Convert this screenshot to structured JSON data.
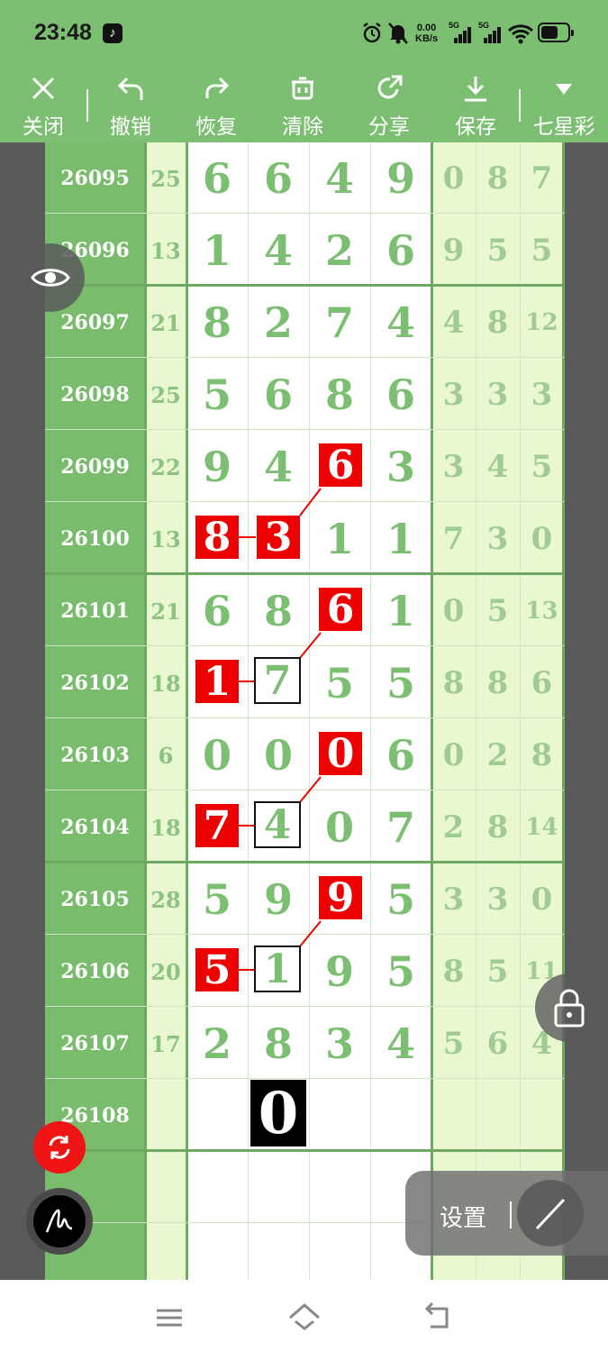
{
  "status": {
    "time": "23:48",
    "net_speed_value": "0.00",
    "net_speed_unit": "KB/s",
    "sim1": "5G",
    "sim2": "5G"
  },
  "toolbar": {
    "close": "关闭",
    "undo": "撤销",
    "redo": "恢复",
    "clear": "清除",
    "share": "分享",
    "save": "保存",
    "lottery": "七星彩"
  },
  "rows": [
    {
      "id": "26095",
      "sum": "25",
      "main": [
        "6",
        "6",
        "4",
        "9"
      ],
      "tail": [
        "0",
        "8",
        "7"
      ]
    },
    {
      "id": "26096",
      "sum": "13",
      "main": [
        "1",
        "4",
        "2",
        "6"
      ],
      "tail": [
        "9",
        "5",
        "5"
      ]
    },
    {
      "id": "26097",
      "sum": "21",
      "main": [
        "8",
        "2",
        "7",
        "4"
      ],
      "tail": [
        "4",
        "8",
        "12"
      ]
    },
    {
      "id": "26098",
      "sum": "25",
      "main": [
        "5",
        "6",
        "8",
        "6"
      ],
      "tail": [
        "3",
        "3",
        "3"
      ]
    },
    {
      "id": "26099",
      "sum": "22",
      "main": [
        "9",
        "4",
        "6",
        "3"
      ],
      "tail": [
        "3",
        "4",
        "5"
      ]
    },
    {
      "id": "26100",
      "sum": "13",
      "main": [
        "8",
        "3",
        "1",
        "1"
      ],
      "tail": [
        "7",
        "3",
        "0"
      ]
    },
    {
      "id": "26101",
      "sum": "21",
      "main": [
        "6",
        "8",
        "6",
        "1"
      ],
      "tail": [
        "0",
        "5",
        "13"
      ]
    },
    {
      "id": "26102",
      "sum": "18",
      "main": [
        "1",
        "7",
        "5",
        "5"
      ],
      "tail": [
        "8",
        "8",
        "6"
      ]
    },
    {
      "id": "26103",
      "sum": "6",
      "main": [
        "0",
        "0",
        "0",
        "6"
      ],
      "tail": [
        "0",
        "2",
        "8"
      ]
    },
    {
      "id": "26104",
      "sum": "18",
      "main": [
        "7",
        "4",
        "0",
        "7"
      ],
      "tail": [
        "2",
        "8",
        "14"
      ]
    },
    {
      "id": "26105",
      "sum": "28",
      "main": [
        "5",
        "9",
        "9",
        "5"
      ],
      "tail": [
        "3",
        "3",
        "0"
      ]
    },
    {
      "id": "26106",
      "sum": "20",
      "main": [
        "5",
        "1",
        "9",
        "5"
      ],
      "tail": [
        "8",
        "5",
        "11"
      ]
    },
    {
      "id": "26107",
      "sum": "17",
      "main": [
        "2",
        "8",
        "3",
        "4"
      ],
      "tail": [
        "5",
        "6",
        "4"
      ]
    },
    {
      "id": "26108",
      "sum": "",
      "main": [
        "",
        "0",
        "",
        ""
      ],
      "tail": [
        "",
        "",
        ""
      ]
    }
  ],
  "settings": {
    "label": "设置"
  },
  "colors": {
    "green": "#7cbf72",
    "red": "#ee0000",
    "light": "#eaf8d2"
  }
}
